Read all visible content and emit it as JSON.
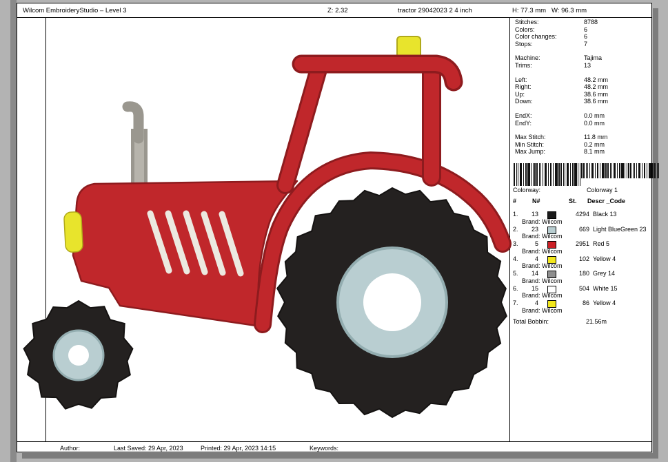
{
  "header": {
    "app_title": "Wilcom EmbroideryStudio – Level 3",
    "zoom": "Z: 2.32",
    "filename": "tractor 29042023 2 4 inch",
    "dims": "H: 77.3 mm   W: 96.3 mm"
  },
  "footer": {
    "author_label": "Author:",
    "last_saved": "Last Saved: 29 Apr, 2023",
    "printed": "Printed: 29 Apr, 2023 14:15",
    "keywords_label": "Keywords:"
  },
  "stats": {
    "groups": [
      [
        {
          "label": "Stitches:",
          "value": "8788"
        },
        {
          "label": "Colors:",
          "value": "6"
        },
        {
          "label": "Color changes:",
          "value": "6"
        },
        {
          "label": "Stops:",
          "value": "7"
        }
      ],
      [
        {
          "label": "Machine:",
          "value": "Tajima"
        },
        {
          "label": "Trims:",
          "value": "13"
        }
      ],
      [
        {
          "label": "Left:",
          "value": "48.2 mm"
        },
        {
          "label": "Right:",
          "value": "48.2 mm"
        },
        {
          "label": "Up:",
          "value": "38.6 mm"
        },
        {
          "label": "Down:",
          "value": "38.6 mm"
        }
      ],
      [
        {
          "label": "EndX:",
          "value": "0.0 mm"
        },
        {
          "label": "EndY:",
          "value": "0.0 mm"
        }
      ],
      [
        {
          "label": "Max Stitch:",
          "value": "11.8 mm"
        },
        {
          "label": "Min Stitch:",
          "value": "0.2 mm"
        },
        {
          "label": "Max Jump:",
          "value": "8.1 mm"
        }
      ]
    ]
  },
  "colorway": {
    "label": "Colorway:",
    "value": "Colorway 1"
  },
  "thread_table": {
    "headers": [
      "#",
      "N#",
      "St.",
      "Descr _Code"
    ],
    "rows": [
      {
        "num": "1.",
        "n": "13",
        "swatch": "#1a1a1a",
        "st": "4294",
        "descr": "Black 13",
        "brand": "Brand: Wilcom"
      },
      {
        "num": "2.",
        "n": "23",
        "swatch": "#b8cdd0",
        "st": "669",
        "descr": "Light BlueGreen 23",
        "brand": "Brand: Wilcom"
      },
      {
        "num": "3.",
        "n": "5",
        "swatch": "#cc2026",
        "st": "2951",
        "descr": "Red 5",
        "brand": "Brand: Wilcom"
      },
      {
        "num": "4.",
        "n": "4",
        "swatch": "#f2e71c",
        "st": "102",
        "descr": "Yellow 4",
        "brand": "Brand: Wilcom"
      },
      {
        "num": "5.",
        "n": "14",
        "swatch": "#8f8f8f",
        "st": "180",
        "descr": "Grey 14",
        "brand": "Brand: Wilcom"
      },
      {
        "num": "6.",
        "n": "15",
        "swatch": "#ffffff",
        "st": "504",
        "descr": "White 15",
        "brand": "Brand: Wilcom"
      },
      {
        "num": "7.",
        "n": "4",
        "swatch": "#f2e71c",
        "st": "86",
        "descr": "Yellow 4",
        "brand": "Brand: Wilcom"
      }
    ],
    "total_label": "Total Bobbin:",
    "total_value": "21.56m"
  },
  "design": {
    "subject": "red tractor embroidery stitchout",
    "colors": {
      "red": "#c0272b",
      "red_dark": "#8e1b1e",
      "black": "#242120",
      "black_dark": "#141211",
      "light_blue_green": "#b9ced1",
      "light_blue_green_dark": "#93adb0",
      "yellow": "#e8e42c",
      "yellow_dark": "#b0a91a",
      "grey": "#9a978f",
      "white_slat": "#ece9e0"
    }
  }
}
